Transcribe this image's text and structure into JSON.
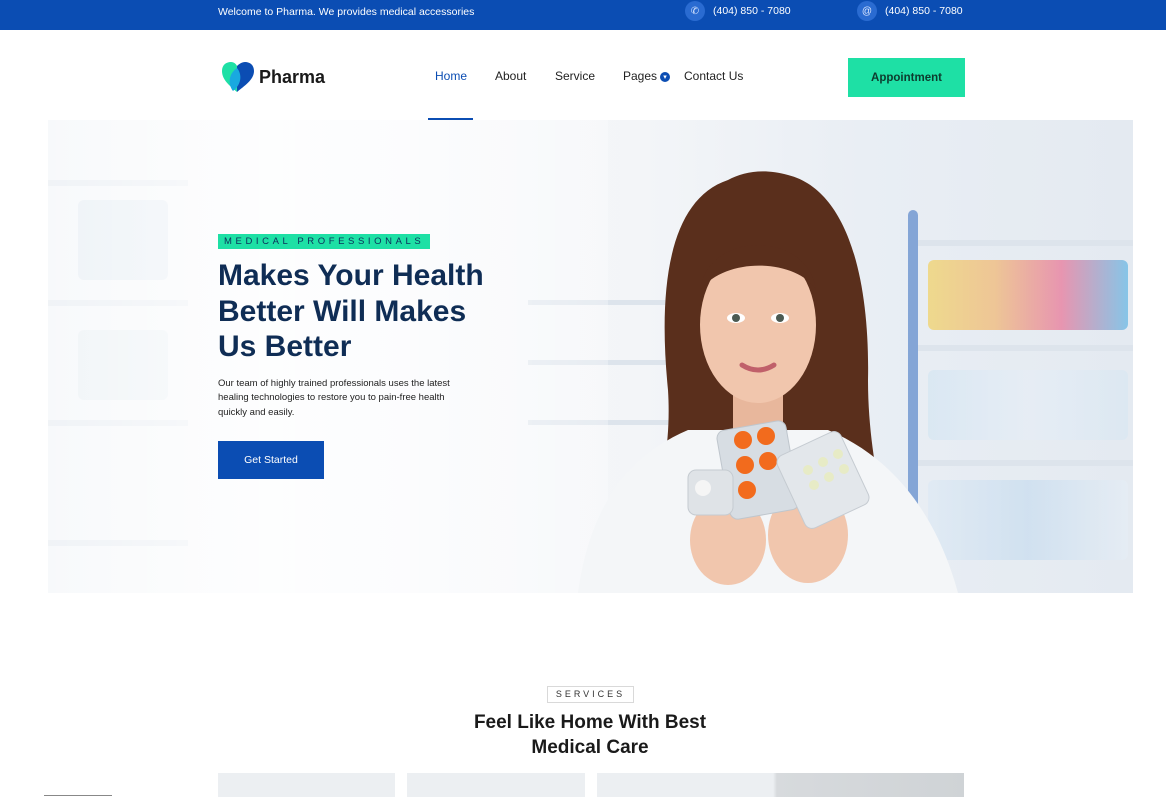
{
  "topbar": {
    "welcome": "Welcome to Pharma. We provides medical accessories",
    "phone": "(404) 850 - 7080",
    "email": "(404) 850 - 7080",
    "phone_icon": "phone-icon",
    "email_icon": "at-icon"
  },
  "brand": {
    "name": "Pharma",
    "logo_icon": "heart-logo-icon"
  },
  "nav": {
    "items": [
      {
        "label": "Home",
        "active": true
      },
      {
        "label": "About",
        "active": false
      },
      {
        "label": "Service",
        "active": false
      },
      {
        "label": "Pages",
        "active": false
      },
      {
        "label": "Contact Us",
        "active": false
      }
    ],
    "appointment": "Appointment"
  },
  "hero": {
    "tagline": "MEDICAL PROFESSIONALS",
    "headline": [
      "Makes Your Health",
      "Better Will Makes",
      "Us Better"
    ],
    "description": "Our team of highly trained professionals uses the latest healing technologies to restore you to pain-free health quickly and easily.",
    "cta": "Get Started"
  },
  "services": {
    "tag": "SERVICES",
    "title_line1": "Feel Like Home With Best",
    "title_line2": "Medical Care"
  },
  "colors": {
    "primary": "#0b4db3",
    "accent": "#1ee0a5",
    "heading": "#0f2d55"
  }
}
